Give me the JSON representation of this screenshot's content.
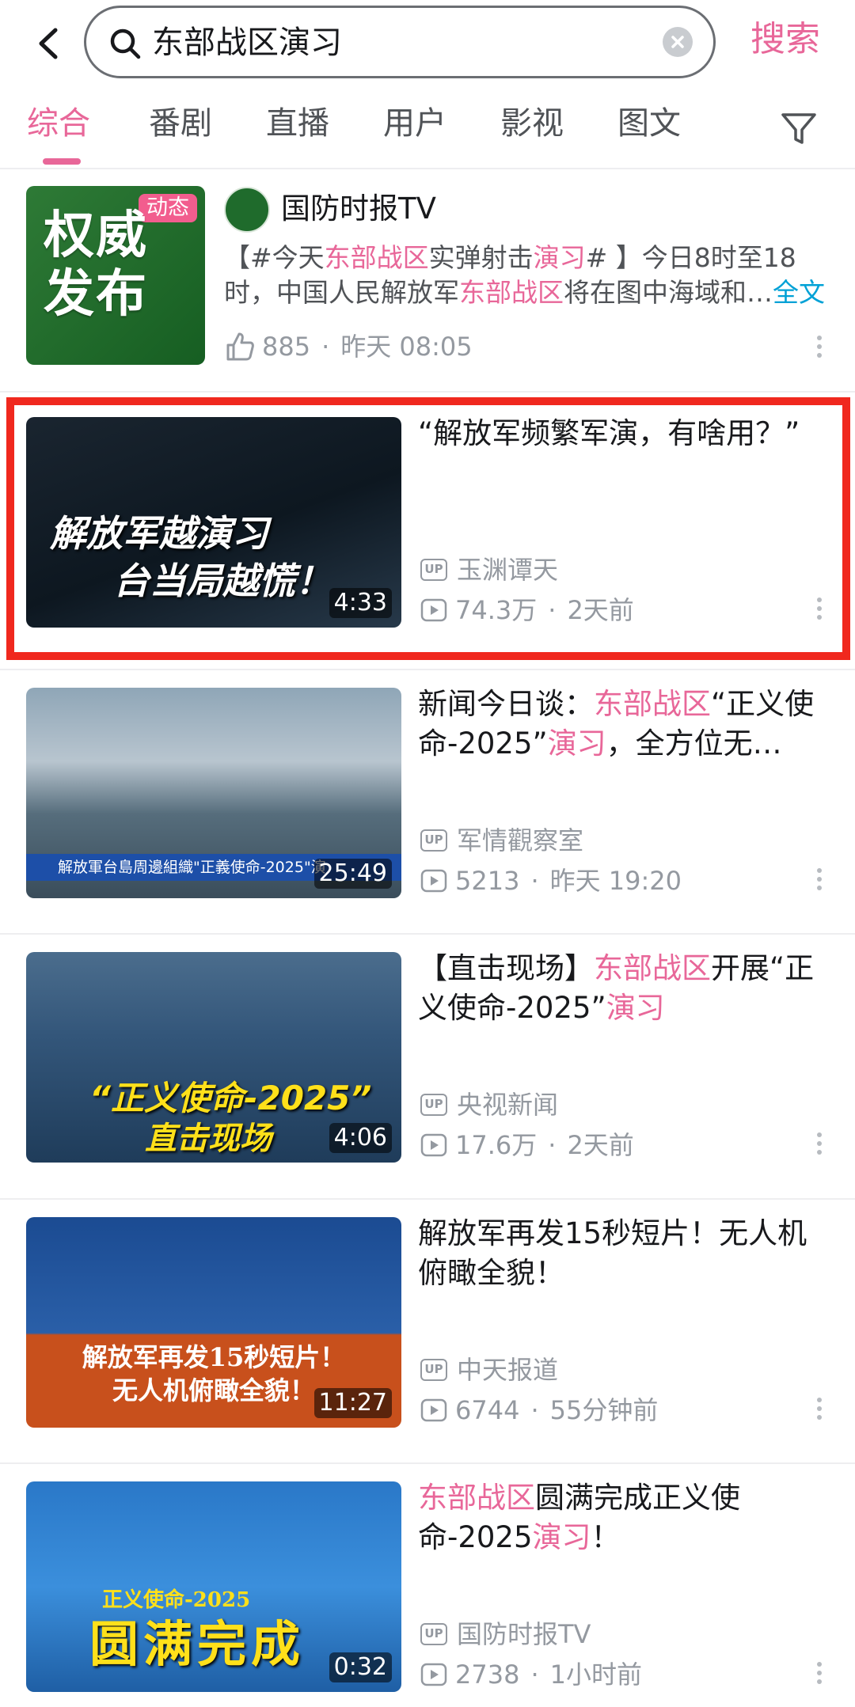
{
  "search": {
    "query": "东部战区演习",
    "submit_label": "搜索"
  },
  "tabs": [
    "综合",
    "番剧",
    "直播",
    "用户",
    "影视",
    "图文"
  ],
  "active_tab": "综合",
  "dynamic_post": {
    "badge": "动态",
    "thumb_text_1": "权威",
    "thumb_text_2": "发布",
    "author": "国防时报TV",
    "text_parts": [
      {
        "t": "【#今天",
        "hl": false
      },
      {
        "t": "东部战区",
        "hl": true
      },
      {
        "t": "实弹射击",
        "hl": false
      },
      {
        "t": "演习",
        "hl": true
      },
      {
        "t": "# 】今日8时至18时，中国人民解放军",
        "hl": false
      },
      {
        "t": "东部战区",
        "hl": true
      },
      {
        "t": "将在图中海域和…",
        "hl": false
      }
    ],
    "full_text_link": "全文",
    "likes": "885",
    "time": "昨天 08:05"
  },
  "videos": [
    {
      "title_parts": [
        {
          "t": "“解放军频繁军演，有啥用？”",
          "hl": false
        }
      ],
      "thumb_line1": "解放军越演习",
      "thumb_line2": "台当局越慌！",
      "duration": "4:33",
      "uploader": "玉渊谭天",
      "views": "74.3万",
      "time": "2天前"
    },
    {
      "title_parts": [
        {
          "t": "新闻今日谈：",
          "hl": false
        },
        {
          "t": "东部战区",
          "hl": true
        },
        {
          "t": "“正义使命-2025”",
          "hl": false
        },
        {
          "t": "演习",
          "hl": true
        },
        {
          "t": "，全方位无…",
          "hl": false
        }
      ],
      "thumb_caption": "解放軍台島周邊組織\"正義使命-2025\"演",
      "duration": "25:49",
      "uploader": "军情觀察室",
      "views": "5213",
      "time": "昨天 19:20"
    },
    {
      "title_parts": [
        {
          "t": "【直击现场】",
          "hl": false
        },
        {
          "t": "东部战区",
          "hl": true
        },
        {
          "t": "开展“正义使命-2025”",
          "hl": false
        },
        {
          "t": "演习",
          "hl": true
        }
      ],
      "thumb_line1": "“正义使命-2025”",
      "thumb_line2": "直击现场",
      "duration": "4:06",
      "uploader": "央视新闻",
      "views": "17.6万",
      "time": "2天前"
    },
    {
      "title_parts": [
        {
          "t": "解放军再发15秒短片！无人机俯瞰全貌！",
          "hl": false
        }
      ],
      "thumb_line1": "解放军再发15秒短片！",
      "thumb_line2": "无人机俯瞰全貌！",
      "duration": "11:27",
      "uploader": "中天报道",
      "views": "6744",
      "time": "55分钟前"
    },
    {
      "title_parts": [
        {
          "t": "东部战区",
          "hl": true
        },
        {
          "t": "圆满完成正义使命-2025",
          "hl": false
        },
        {
          "t": "演习",
          "hl": true
        },
        {
          "t": "！",
          "hl": false
        }
      ],
      "thumb_line1": "正义使命-2025",
      "thumb_line2": "圆满完成",
      "duration": "0:32",
      "uploader": "国防时报TV",
      "views": "2738",
      "time": "1小时前"
    }
  ],
  "up_badge": "UP",
  "colors": {
    "accent": "#e86799",
    "highlight_box": "#f0281e",
    "link": "#00a1d6",
    "meta": "#9499a0"
  }
}
